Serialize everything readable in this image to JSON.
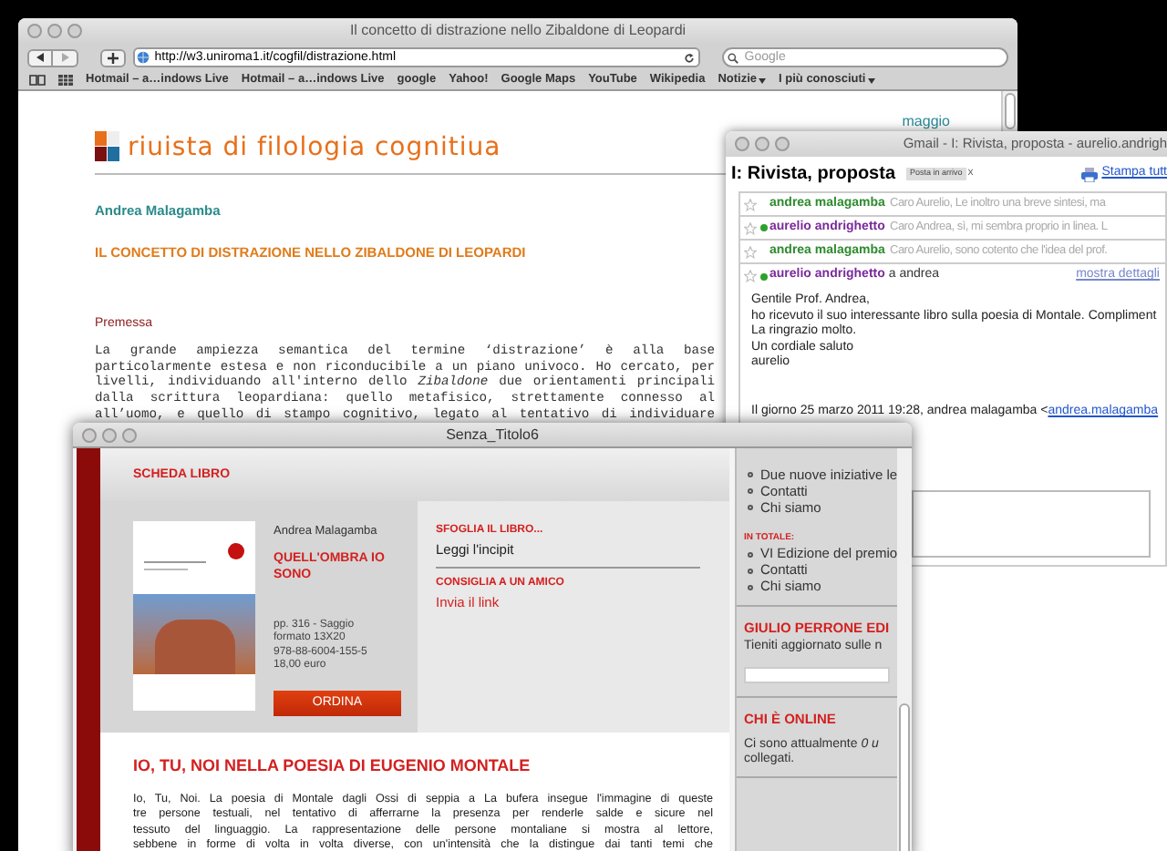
{
  "browser": {
    "title": "Il concetto di distrazione nello Zibaldone di Leopardi",
    "url": "http://w3.uniroma1.it/cogfil/distrazione.html",
    "search_placeholder": "Google",
    "bookmarks": [
      {
        "label": "Hotmail – a…indows Live",
        "menu": false
      },
      {
        "label": "Hotmail – a…indows Live",
        "menu": false
      },
      {
        "label": "google",
        "menu": false
      },
      {
        "label": "Yahoo!",
        "menu": false
      },
      {
        "label": "Google Maps",
        "menu": false
      },
      {
        "label": "YouTube",
        "menu": false
      },
      {
        "label": "Wikipedia",
        "menu": false
      },
      {
        "label": "Notizie",
        "menu": true
      },
      {
        "label": "I più conosciuti",
        "menu": true
      }
    ],
    "page": {
      "corner_link": "maggio",
      "logo_text": "riuista di filologia cognitiua",
      "author": "Andrea Malagamba",
      "title": "IL CONCETTO DI DISTRAZIONE NELLO ZIBALDONE DI LEOPARDI",
      "section": "Premessa",
      "paragraph_lines": [
        "La grande ampiezza semantica del termine ‘distrazione’ è alla base",
        "particolarmente estesa e non riconducibile a un piano univoco. Ho cercato, per",
        "livelli, individuando all'interno dello *Zibaldone* due orientamenti principali",
        "dalla scrittura leopardiana: quello metafisico, strettamente connesso al",
        "all’uomo, e quello di stampo cognitivo, legato al tentativo di individuare"
      ]
    }
  },
  "gmail": {
    "title": "Gmail - I: Rivista, proposta - aurelio.andrigh",
    "subject": "I: Rivista, proposta",
    "label": "Posta in arrivo",
    "label_remove": "X",
    "print_link": "Stampa tutt",
    "messages": [
      {
        "sender": "andrea malagamba",
        "snippet": "Caro Aurelio, Le inoltro una breve sintesi, ma",
        "online": false,
        "color": "#2e8b2e"
      },
      {
        "sender": "aurelio andrighetto",
        "snippet": "Caro Andrea, sì, mi sembra proprio in linea. L",
        "online": true,
        "color": "#7a2a9a"
      },
      {
        "sender": "andrea malagamba",
        "snippet": "Caro Aurelio, sono cotento che l'idea del prof.",
        "online": false,
        "color": "#2e8b2e"
      }
    ],
    "open_message": {
      "sender": "aurelio andrighetto",
      "online": true,
      "color": "#7a2a9a",
      "recipient": "a andrea",
      "details_link": "mostra dettagli",
      "body_lines": [
        "Gentile Prof. Andrea,",
        "ho ricevuto il suo interessante libro sulla poesia di Montale. Compliment",
        "La ringrazio molto.",
        "Un cordiale saluto",
        "aurelio"
      ],
      "quote_intro": "Il giorno 25 marzo 2011 19:28, andrea malagamba <",
      "quote_email": "andrea.malagamba"
    }
  },
  "book_window": {
    "title": "Senza_Titolo6",
    "header": "SCHEDA LIBRO",
    "author": "Andrea Malagamba",
    "book_title": "QUELL'OMBRA IO SONO",
    "details": [
      "pp. 316 - Saggio",
      "formato 13X20",
      "978-88-6004-155-5",
      "18,00 euro"
    ],
    "order_button": "ORDINA",
    "actions": [
      {
        "heading": "SFOGLIA IL LIBRO...",
        "link": "Leggi l'incipit"
      },
      {
        "heading": "CONSIGLIA A UN AMICO",
        "link": "Invia il link"
      }
    ],
    "article_heading": "IO, TU, NOI NELLA POESIA DI EUGENIO MONTALE",
    "article_lines": [
      "Io, Tu, Noi. La poesia di Montale dagli Ossi di seppia a La bufera insegue l'immagine di queste",
      "tre persone testuali, nel tentativo di afferrarne la presenza per renderle salde e sicure nel",
      "tessuto del linguaggio. La rappresentazione delle persone montaliane si mostra al lettore,",
      "sebbene in forme di volta in volta diverse, con un'intensità che la distingue dai tanti temi che"
    ],
    "sidebar": [
      {
        "kind": "list",
        "items": [
          "Due nuove iniziative le",
          "Contatti",
          "Chi siamo"
        ]
      },
      {
        "kind": "list",
        "heading": "IN TOTALE:",
        "items": [
          "VI Edizione del premio",
          "Contatti",
          "Chi siamo"
        ]
      },
      {
        "kind": "newsletter",
        "heading": "GIULIO PERRONE EDI",
        "lines": [
          "Tieniti aggiornato sulle n"
        ]
      },
      {
        "kind": "online",
        "heading": "CHI È ONLINE",
        "lines": [
          "Ci sono attualmente *0 u*",
          "collegati."
        ]
      }
    ]
  }
}
